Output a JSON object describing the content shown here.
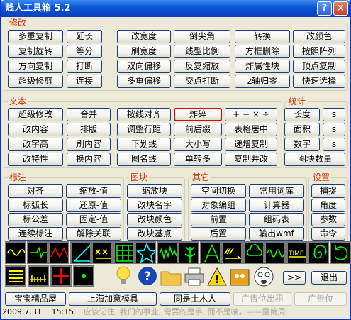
{
  "title": "贱人工具箱 5.2",
  "groups": {
    "modify": "修改",
    "text": "文本",
    "stats": "统计",
    "annot": "标注",
    "block": "图块",
    "other": "其它",
    "settings": "设置"
  },
  "modify": [
    [
      "多重复制",
      "延长",
      "改宽度",
      "倒尖角",
      "转换",
      "改颜色"
    ],
    [
      "复制旋转",
      "等分",
      "刷宽度",
      "线型比例",
      "方框删除",
      "按照阵列"
    ],
    [
      "方向复制",
      "打断",
      "双向偏移",
      "反复缩放",
      "炸属性块",
      "顶点复制"
    ],
    [
      "超级修剪",
      "连接",
      "多重偏移",
      "交点打断",
      "z轴归零",
      "快速选择"
    ]
  ],
  "text": [
    [
      "超级修改",
      "合并",
      "按线对齐",
      "炸碎",
      "+ − × ÷"
    ],
    [
      "改内容",
      "排版",
      "调整行距",
      "前后缀",
      "表格居中"
    ],
    [
      "改字高",
      "刷内容",
      "下划线",
      "大小写",
      "递增复制"
    ],
    [
      "改特性",
      "换内容",
      "图名线",
      "单转多",
      "复制并改"
    ]
  ],
  "stats": {
    "len": "长度",
    "area": "面积",
    "num": "数字",
    "s": "s",
    "blockcount": "图块数量"
  },
  "annot": [
    "对齐",
    "缩放-值",
    "标弧长",
    "还原-值",
    "标公差",
    "固定-值",
    "连续标注",
    "解除关联"
  ],
  "block": [
    "缩放块",
    "改块名字",
    "改块颜色",
    "改块基点"
  ],
  "other": [
    "空间切换",
    "常用词库",
    "对象编组",
    "计算器",
    "前置",
    "组码表",
    "后置",
    "输出wmf"
  ],
  "settings": [
    "捕捉",
    "角度",
    "参数",
    "命令"
  ],
  "toolbar_icons": [
    "wavy-line-icon",
    "break-line-icon",
    "zigzag-icon",
    "angle-line-icon",
    "xxx-hatch-icon",
    "grid-table-icon",
    "star-icon",
    "wave-noise-icon",
    "plant-icon",
    "compass-a-icon",
    "xxx-arrow-icon",
    "cloud-icon",
    "sine-wave-icon",
    "time-text-icon",
    "spiral-icon",
    "rotate-icon"
  ],
  "toolbar2_icons": [
    "bars-icon",
    "dimension-line-icon",
    "cross-icon",
    "dot-icon",
    "bulb-icon",
    "help-icon",
    "folder-icon",
    "printer-icon",
    "warning-icon",
    "monster-icon",
    "scared-face-icon"
  ],
  "nav": {
    "more": ">>",
    "exit": "退出"
  },
  "ads": [
    "宝宝精品屋",
    "上海加意模具",
    "同是土木人",
    "广告位出租",
    "广告位"
  ],
  "status": {
    "date": "2009.7.31",
    "time": "15:15",
    "quote": "应该记住, 我们的事业, 需要的是手, 而不是嘴。——童第周"
  },
  "titlebuttons": {
    "help": "?",
    "close": "×"
  }
}
